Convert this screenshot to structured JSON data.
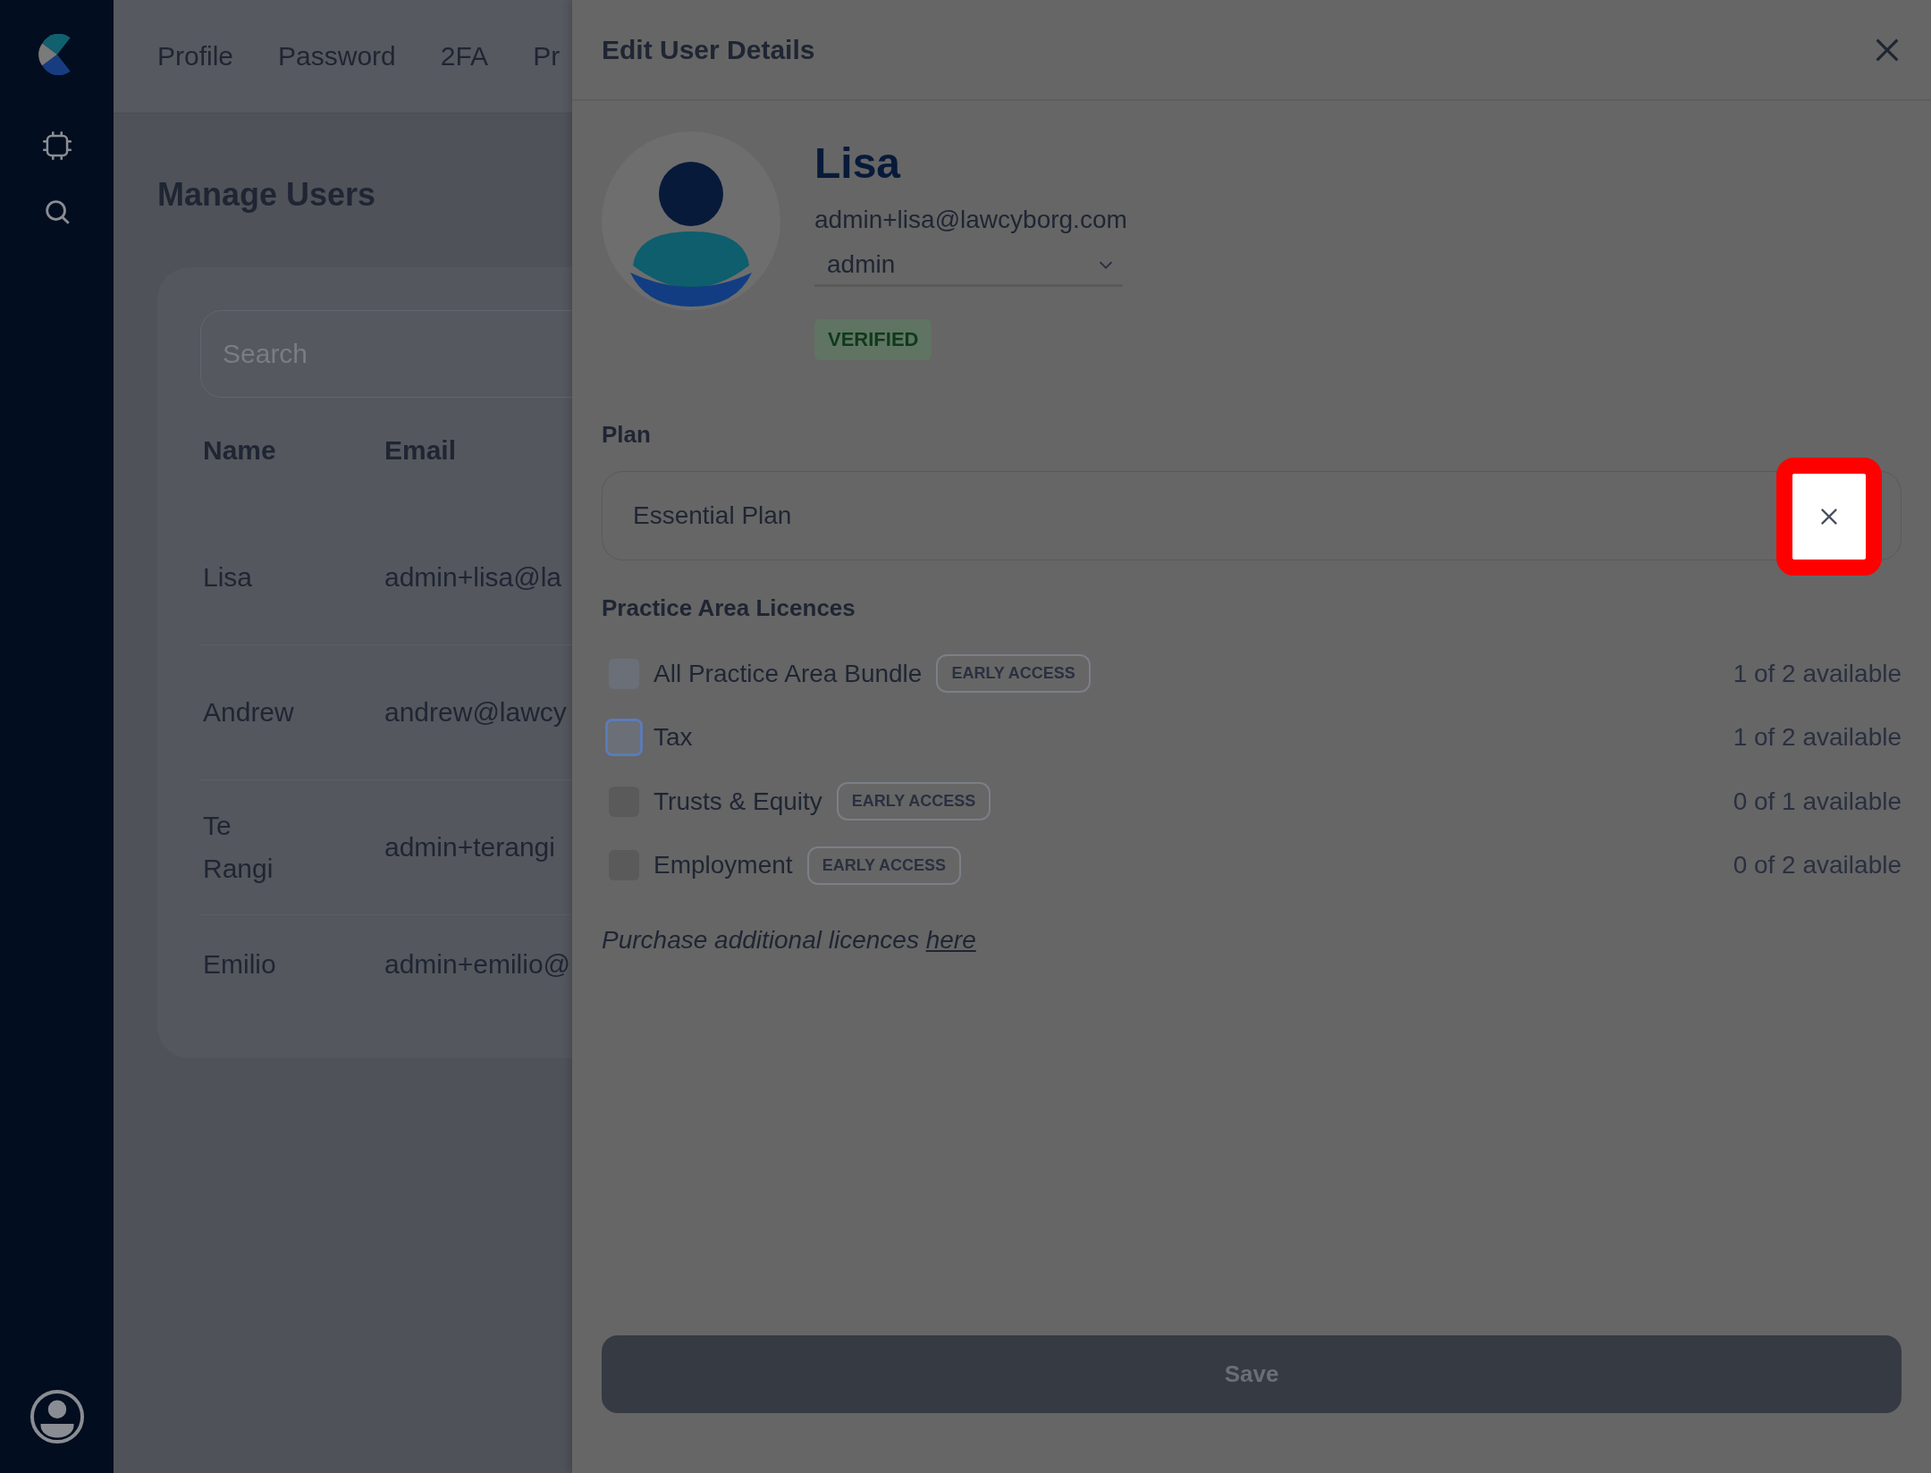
{
  "nav_tabs": [
    "Profile",
    "Password",
    "2FA",
    "Pr"
  ],
  "page": {
    "title": "Manage Users",
    "search": {
      "placeholder": "Search"
    },
    "table": {
      "columns": [
        "Name",
        "Email"
      ],
      "rows": [
        {
          "name": "Lisa",
          "email": "admin+lisa@la"
        },
        {
          "name": "Andrew",
          "email": "andrew@lawcy"
        },
        {
          "name": "Te Rangi",
          "email": "admin+terangi"
        },
        {
          "name": "Emilio",
          "email": "admin+emilio@"
        }
      ]
    }
  },
  "panel": {
    "title": "Edit User Details",
    "user": {
      "name": "Lisa",
      "email": "admin+lisa@lawcyborg.com",
      "role": "admin",
      "status": "VERIFIED"
    },
    "plan": {
      "label": "Plan",
      "value": "Essential Plan"
    },
    "licences": {
      "heading": "Practice Area Licences",
      "items": [
        {
          "label": "All Practice Area Bundle",
          "tag": "EARLY ACCESS",
          "availability": "1 of 2 available",
          "checked": false,
          "focused": false,
          "disabled": false
        },
        {
          "label": "Tax",
          "availability": "1 of 2 available",
          "checked": false,
          "focused": true,
          "disabled": false
        },
        {
          "label": "Trusts & Equity",
          "tag": "EARLY ACCESS",
          "availability": "0 of 1 available",
          "checked": false,
          "focused": false,
          "disabled": true
        },
        {
          "label": "Employment",
          "tag": "EARLY ACCESS",
          "availability": "0 of 2 available",
          "checked": false,
          "focused": false,
          "disabled": true
        }
      ]
    },
    "purchase": {
      "text": "Purchase additional licences",
      "link": "here"
    },
    "save": "Save"
  }
}
